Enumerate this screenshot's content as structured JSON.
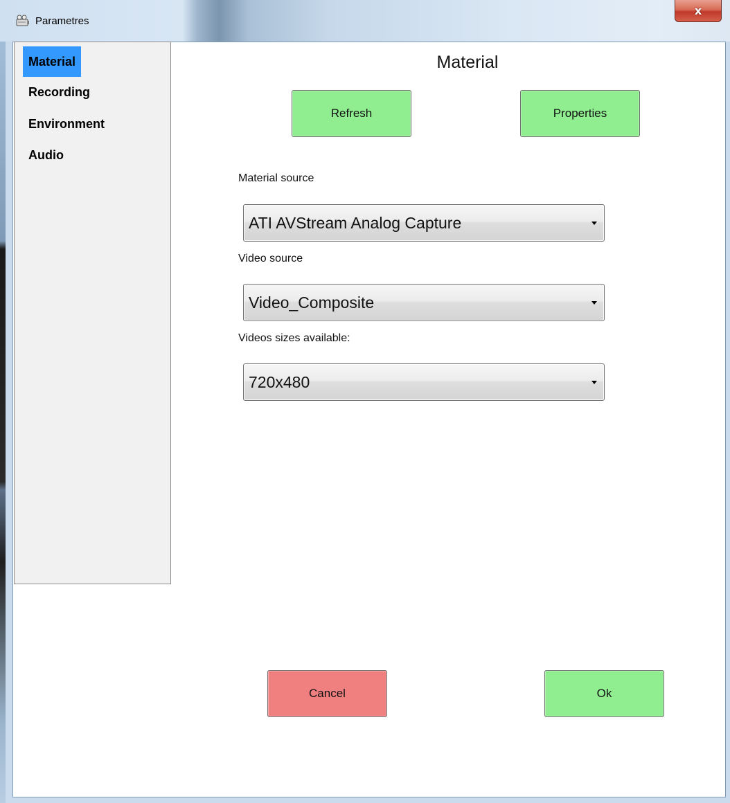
{
  "window": {
    "title": "Parametres",
    "close_glyph": "x",
    "title_icon": "projector-icon"
  },
  "sidebar": {
    "items": [
      {
        "label": "Material",
        "selected": true
      },
      {
        "label": "Recording",
        "selected": false
      },
      {
        "label": "Environment",
        "selected": false
      },
      {
        "label": "Audio",
        "selected": false
      }
    ]
  },
  "main": {
    "title": "Material",
    "refresh_label": "Refresh",
    "properties_label": "Properties",
    "material_source": {
      "label": "Material source",
      "value": "ATI AVStream Analog Capture"
    },
    "video_source": {
      "label": "Video source",
      "value": "Video_Composite"
    },
    "video_sizes": {
      "label": "Videos sizes available:",
      "value": "720x480"
    }
  },
  "footer": {
    "cancel_label": "Cancel",
    "ok_label": "Ok"
  },
  "colors": {
    "green_button": "#90ee90",
    "red_button": "#f08080",
    "selection": "#3399ff"
  }
}
